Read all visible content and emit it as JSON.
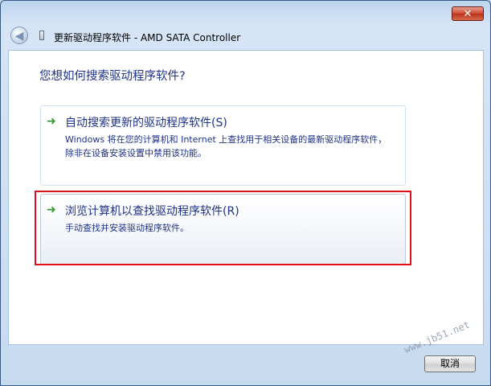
{
  "window": {
    "title": "更新驱动程序软件 - AMD SATA Controller",
    "close_label": "✕",
    "back_label": "◀"
  },
  "main": {
    "question": "您想如何搜索驱动程序软件?",
    "options": [
      {
        "title": "自动搜索更新的驱动程序软件(S)",
        "description": "Windows 将在您的计算机和 Internet 上查找用于相关设备的最新驱动程序软件，除非在设备安装设置中禁用该功能。"
      },
      {
        "title": "浏览计算机以查找驱动程序软件(R)",
        "description": "手动查找并安装驱动程序软件。"
      }
    ]
  },
  "footer": {
    "cancel_label": "取消"
  },
  "watermark": "www.jb51.net",
  "colors": {
    "link_text": "#1e3287",
    "arrow_green": "#2f9b2f",
    "highlight_red": "#e0101a"
  },
  "icons": {
    "back": "back-arrow-icon",
    "device": "device-icon",
    "option_arrow": "green-arrow-icon"
  }
}
